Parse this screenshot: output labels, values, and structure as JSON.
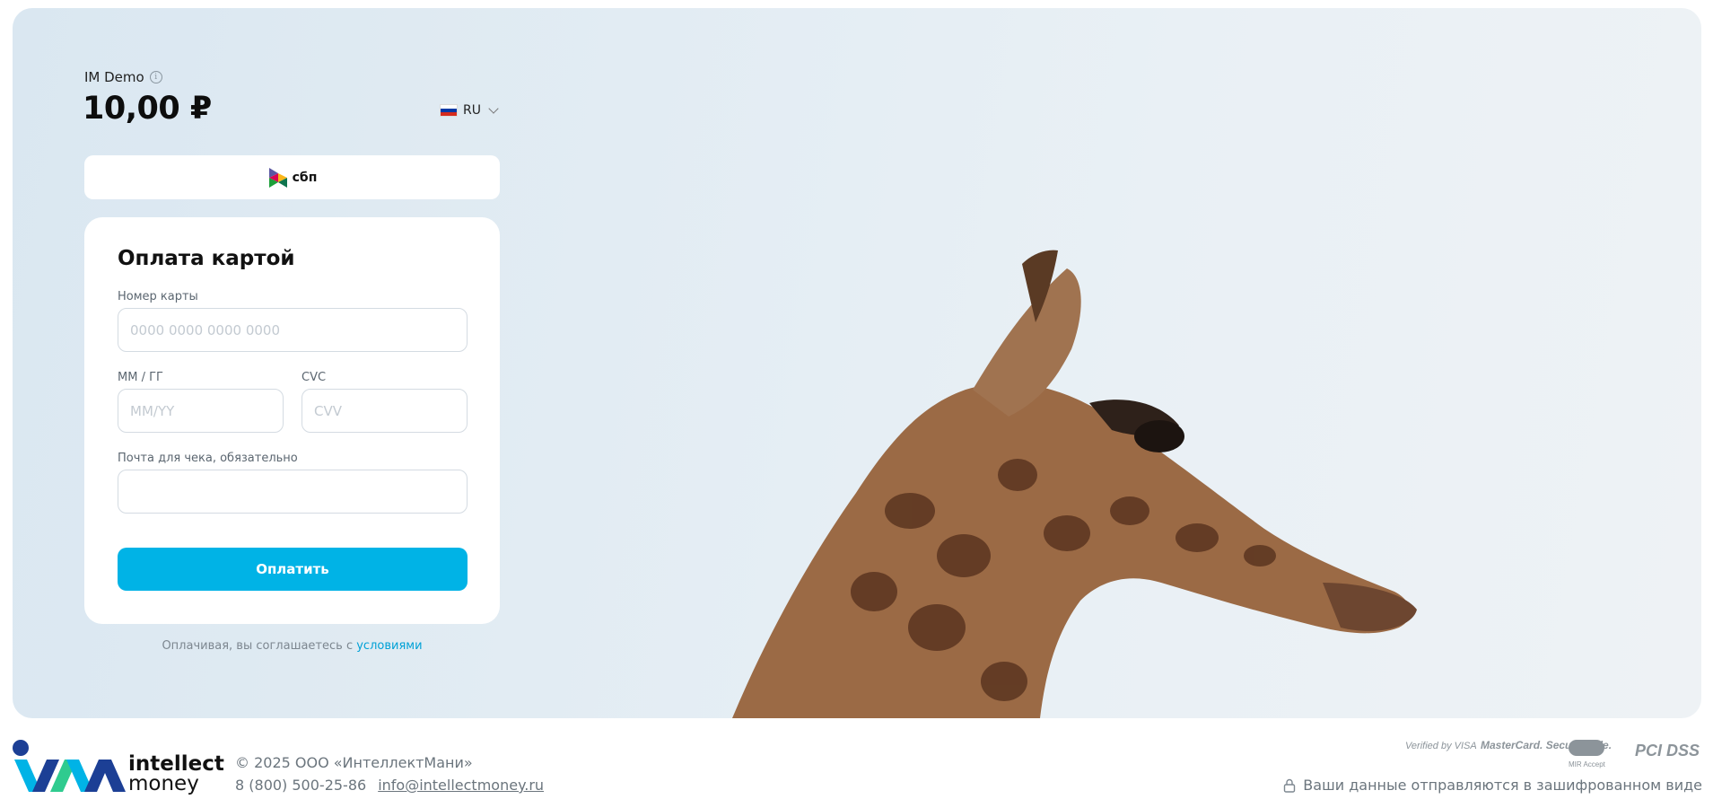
{
  "merchant": {
    "name": "IM Demo",
    "amount": "10,00 ₽"
  },
  "language": {
    "code": "RU"
  },
  "sbp": {
    "label": "сбп"
  },
  "card_form": {
    "title": "Оплата картой",
    "card_number_label": "Номер карты",
    "card_number_placeholder": "0000 0000 0000 0000",
    "expiry_label": "ММ / ГГ",
    "expiry_placeholder": "MM/YY",
    "cvc_label": "CVC",
    "cvc_placeholder": "CVV",
    "email_label": "Почта для чека, обязательно",
    "email_value": "",
    "pay_button": "Оплатить"
  },
  "terms": {
    "text": "Оплачивая, вы соглашаетесь с ",
    "link": "условиями"
  },
  "footer": {
    "brand_line1": "intellect",
    "brand_line2": "money",
    "copyright": "© 2025 ООО «ИнтеллектМани»",
    "phone": "8 (800) 500-25-86",
    "email": "info@intellectmoney.ru",
    "badges": [
      "Verified by VISA",
      "MasterCard. SecureCode.",
      "MIR Accept",
      "PCI DSS"
    ],
    "secure_text": "Ваши данные отправляются в зашифрованном виде"
  },
  "colors": {
    "accent": "#00b3e6",
    "link": "#00a1d6",
    "hero_bg": "#dfeaf2"
  }
}
